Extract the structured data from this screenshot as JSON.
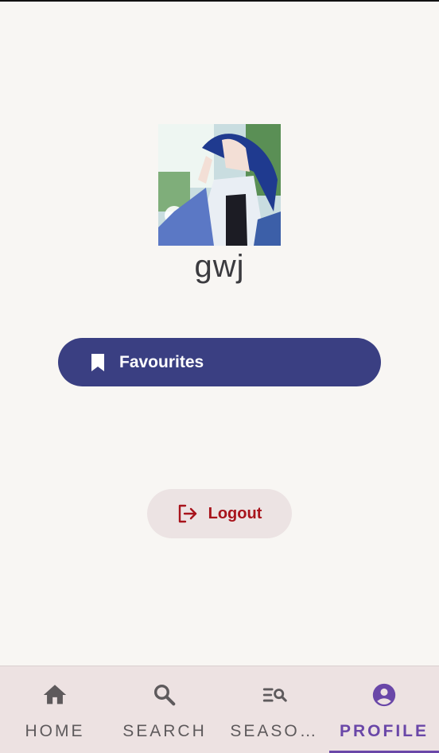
{
  "profile": {
    "username": "gwj"
  },
  "actions": {
    "favourites_label": "Favourites",
    "logout_label": "Logout"
  },
  "icons": {
    "favourites": "bookmark-icon",
    "logout": "logout-icon",
    "home": "home-icon",
    "search": "search-icon",
    "seasons": "list-search-icon",
    "profile": "account-circle-icon"
  },
  "colors": {
    "primary_button": "#3a3f82",
    "logout_text": "#a8141c",
    "nav_active": "#6a47a8",
    "nav_inactive": "#5e5a5c",
    "background": "#f8f6f3",
    "nav_background": "#ede2e2"
  },
  "bottom_nav": {
    "items": [
      {
        "label": "HOME",
        "active": false
      },
      {
        "label": "SEARCH",
        "active": false
      },
      {
        "label": "SEASO…",
        "active": false
      },
      {
        "label": "PROFILE",
        "active": true
      }
    ]
  }
}
